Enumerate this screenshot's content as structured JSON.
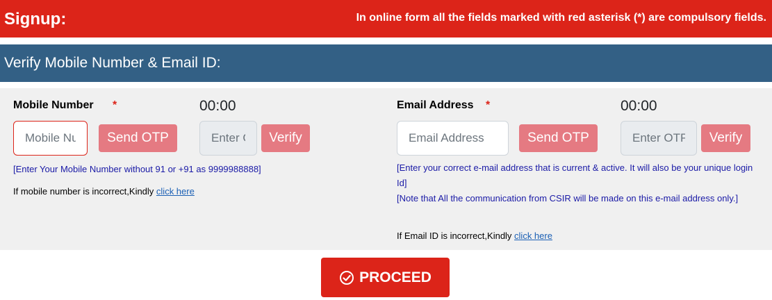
{
  "header": {
    "title": "Signup:",
    "note": "In online form all the fields marked with red asterisk (*) are compulsory fields."
  },
  "section": {
    "title": "Verify Mobile Number & Email ID:"
  },
  "mobile": {
    "label": "Mobile Number",
    "asterisk": "*",
    "timer": "00:00",
    "input_placeholder": "Mobile Number",
    "send_otp_label": "Send OTP",
    "otp_placeholder": "Enter OTP",
    "verify_label": "Verify",
    "hint": "[Enter Your Mobile Number without 91 or +91 as 9999988888]",
    "incorrect_text": "If mobile number is incorrect,Kindly ",
    "click_here": "click here"
  },
  "email": {
    "label": "Email Address",
    "asterisk": "*",
    "timer": "00:00",
    "input_placeholder": "Email Address",
    "send_otp_label": "Send OTP",
    "otp_placeholder": "Enter OTP",
    "verify_label": "Verify",
    "hint1": "[Enter your correct e-mail address that is current & active. It will also be your unique login Id]",
    "hint2": "[Note that All the communication from CSIR will be made on this e-mail address only.]",
    "incorrect_text": "If Email ID is incorrect,Kindly ",
    "click_here": "click here"
  },
  "proceed": {
    "label": "PROCEED",
    "icon": "check-circle-icon"
  },
  "colors": {
    "red": "#dc2419",
    "blue": "#336085",
    "button_pink": "#e57a82",
    "panel": "#f0f0f0"
  }
}
